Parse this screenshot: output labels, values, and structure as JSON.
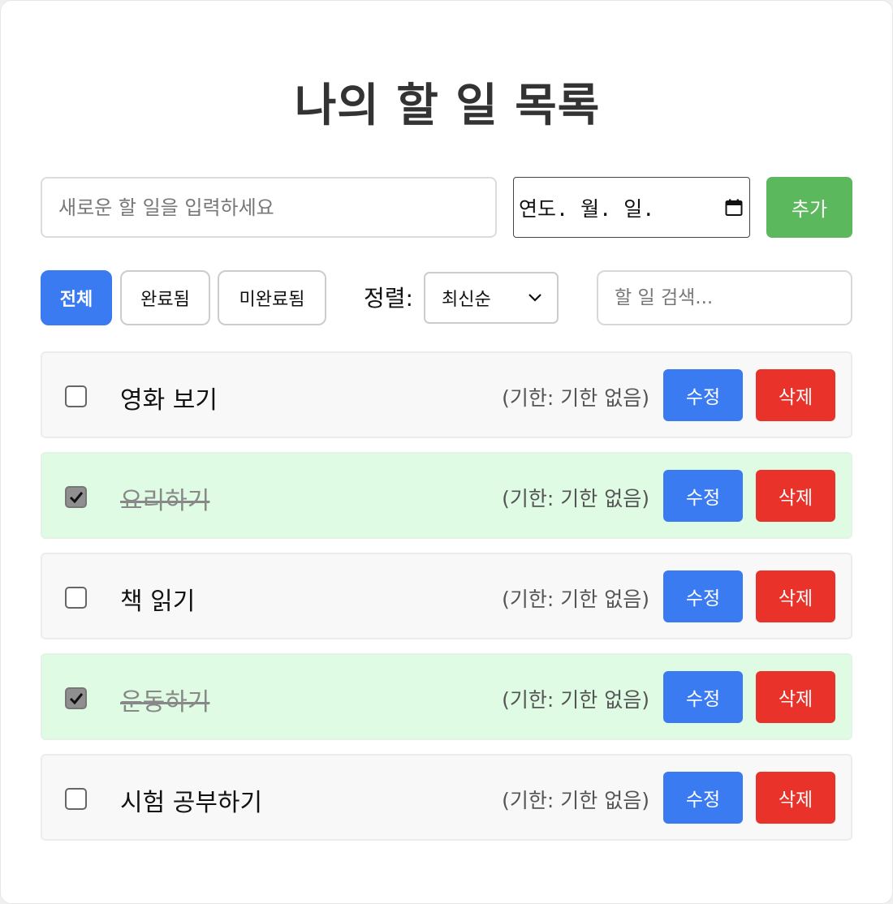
{
  "title": "나의 할 일 목록",
  "add_form": {
    "placeholder": "새로운 할 일을 입력하세요",
    "date_placeholder": "연도. 월. 일.",
    "add_label": "추가"
  },
  "filters": {
    "all": "전체",
    "completed": "완료됨",
    "incomplete": "미완료됨",
    "active": "all"
  },
  "sort": {
    "label": "정렬:",
    "value": "최신순"
  },
  "search": {
    "placeholder": "할 일 검색..."
  },
  "buttons": {
    "edit": "수정",
    "delete": "삭제"
  },
  "todos": [
    {
      "text": "영화 보기",
      "due": "(기한: 기한 없음)",
      "done": false
    },
    {
      "text": "요리하기",
      "due": "(기한: 기한 없음)",
      "done": true
    },
    {
      "text": "책 읽기",
      "due": "(기한: 기한 없음)",
      "done": false
    },
    {
      "text": "운동하기",
      "due": "(기한: 기한 없음)",
      "done": true
    },
    {
      "text": "시험 공부하기",
      "due": "(기한: 기한 없음)",
      "done": false
    }
  ],
  "colors": {
    "primary": "#3a7bf2",
    "add": "#5cb85c",
    "delete": "#e8322a",
    "done_row": "#dffbe4"
  }
}
